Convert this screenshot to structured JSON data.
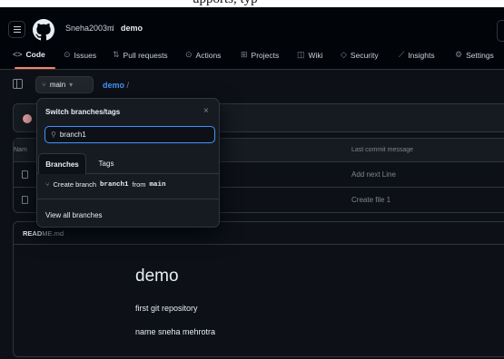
{
  "caption_fragment": "upports, typ",
  "header": {
    "owner": "Sneha2003m",
    "separator": "/",
    "repo": "demo",
    "tabs": [
      {
        "icon": "<>",
        "label": "Code"
      },
      {
        "icon": "⊙",
        "label": "Issues"
      },
      {
        "icon": "⇅",
        "label": "Pull requests"
      },
      {
        "icon": "⊙",
        "label": "Actions"
      },
      {
        "icon": "⊞",
        "label": "Projects"
      },
      {
        "icon": "◫",
        "label": "Wiki"
      },
      {
        "icon": "◇",
        "label": "Security"
      },
      {
        "icon": "⟋",
        "label": "Insights"
      },
      {
        "icon": "⚙",
        "label": "Settings"
      }
    ]
  },
  "toolbar": {
    "branch": "main",
    "branch_caret": "▾",
    "breadcrumb_repo": "demo",
    "breadcrumb_sep": " /"
  },
  "files": {
    "header_name": "Nam",
    "header_commit": "Last commit message",
    "rows": [
      {
        "message": "Add next Line"
      },
      {
        "message": "Create file 1"
      }
    ]
  },
  "readme": {
    "label_bold": "READ",
    "label_rest": "ME.md",
    "title": "demo",
    "line1": "first git repository",
    "line2": "name sneha mehrotra"
  },
  "dropdown": {
    "title": "Switch branches/tags",
    "close": "×",
    "search_value": "branch1",
    "tab_branches": "Branches",
    "tab_tags": "Tags",
    "create_prefix": "Create branch",
    "create_branch": "branch1",
    "create_from": "from",
    "create_source": "main",
    "view_all": "View all branches"
  },
  "colors": {
    "background": "#0d1117",
    "accent_tab": "#f78166",
    "link": "#4493f8"
  }
}
